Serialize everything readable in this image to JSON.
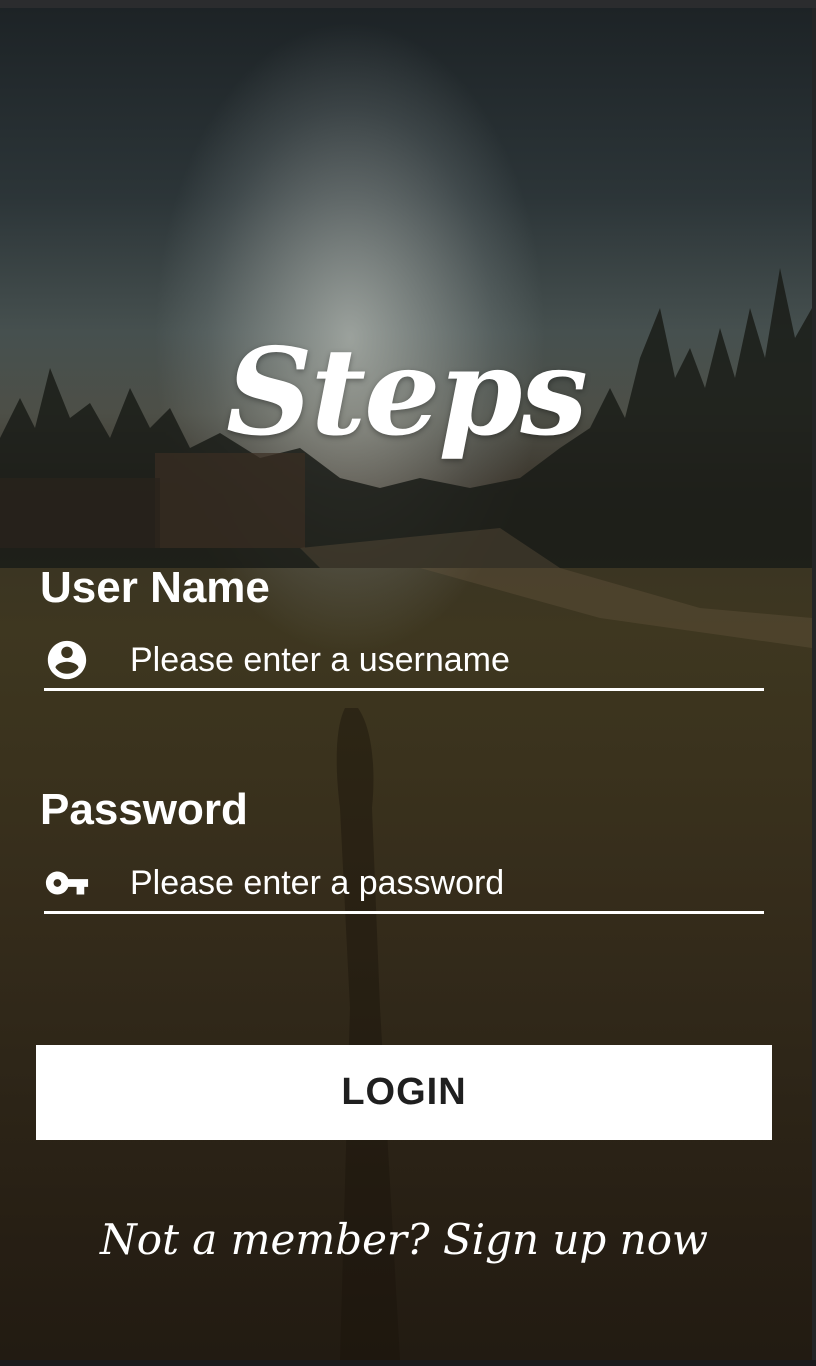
{
  "app": {
    "logo_text": "Steps"
  },
  "form": {
    "username": {
      "label": "User Name",
      "placeholder": "Please enter a username",
      "value": "",
      "icon": "account-circle-icon"
    },
    "password": {
      "label": "Password",
      "placeholder": "Please enter a password",
      "value": "",
      "icon": "key-icon"
    },
    "login_label": "LOGIN",
    "signup_text": "Not a member? Sign up now"
  },
  "colors": {
    "text": "#ffffff",
    "button_bg": "#ffffff",
    "button_text": "#1f1f1f"
  }
}
